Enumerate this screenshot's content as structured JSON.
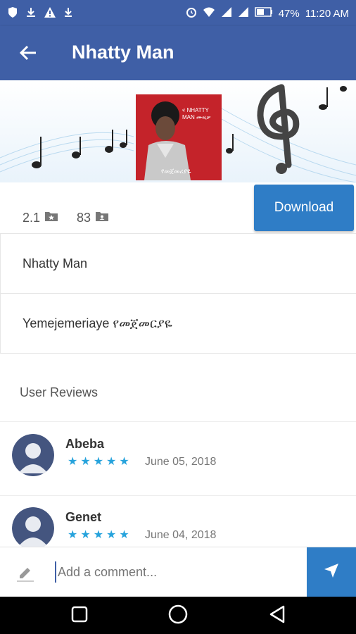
{
  "status_bar": {
    "battery": "47%",
    "time": "11:20 AM"
  },
  "app_bar": {
    "title": "Nhatty Man"
  },
  "album": {
    "cover_text_top": "ና NHATTY MAN ሙዚቃ",
    "cover_text_bottom": "የመጀመሪያዬ"
  },
  "stats": {
    "rating": "2.1",
    "downloads": "83"
  },
  "download_label": "Download",
  "info_rows": [
    "Nhatty Man",
    "Yemejemeriaye የመጀመርያዬ"
  ],
  "reviews_title": "User Reviews",
  "reviews": [
    {
      "name": "Abeba",
      "stars": "★★★★★",
      "date": "June 05, 2018"
    },
    {
      "name": "Genet",
      "stars": "★★★★★",
      "date": "June 04, 2018"
    }
  ],
  "comment": {
    "placeholder": "Add a comment..."
  },
  "colors": {
    "primary": "#3f5fa6",
    "accent": "#2f7dc6",
    "star": "#27a3dc"
  }
}
